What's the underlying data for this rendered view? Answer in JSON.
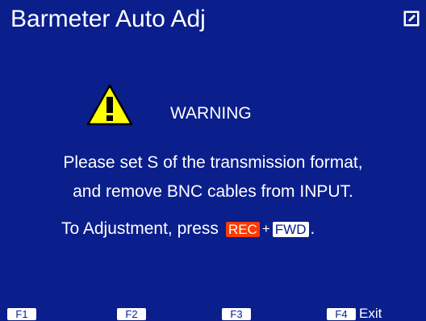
{
  "header": {
    "title": "Barmeter Auto Adj",
    "edit_icon": "edit-icon"
  },
  "warning": {
    "icon": "warning-icon",
    "label": "WARNING",
    "line1": "Please set S of the transmission format,",
    "line2": "and remove BNC cables from INPUT.",
    "instruction_prefix": "To Adjustment, press",
    "key_rec": "REC",
    "plus": "+",
    "key_fwd": "FWD",
    "instruction_suffix": "."
  },
  "softkeys": [
    {
      "key": "F1",
      "label": ""
    },
    {
      "key": "F2",
      "label": ""
    },
    {
      "key": "F3",
      "label": ""
    },
    {
      "key": "F4",
      "label": "Exit"
    }
  ],
  "colors": {
    "background": "#0a1e8c",
    "text": "#ffffff",
    "rec_key": "#ff3a00",
    "warning_yellow": "#ffff00"
  }
}
